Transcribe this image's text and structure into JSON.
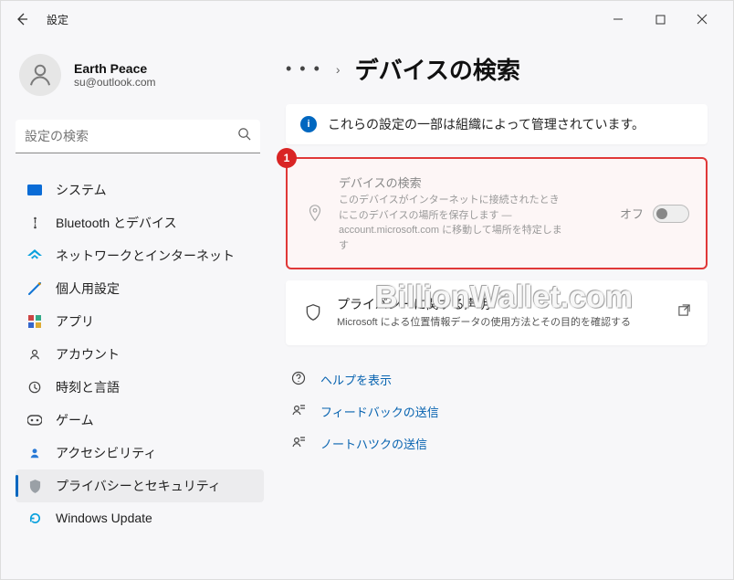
{
  "titlebar": {
    "title": "設定"
  },
  "profile": {
    "name": "Earth Peace",
    "email": "su@outlook.com"
  },
  "search": {
    "placeholder": "設定の検索"
  },
  "nav": [
    {
      "label": "システム",
      "color": "#0a6cd6"
    },
    {
      "label": "Bluetooth とデバイス",
      "color": "#444"
    },
    {
      "label": "ネットワークとインターネット",
      "color": "#0aa1dd"
    },
    {
      "label": "個人用設定",
      "color": "#1275d4"
    },
    {
      "label": "アプリ",
      "color": "#8a5a33"
    },
    {
      "label": "アカウント",
      "color": "#3a3a3a"
    },
    {
      "label": "時刻と言語",
      "color": "#3a3a3a"
    },
    {
      "label": "ゲーム",
      "color": "#3a3a3a"
    },
    {
      "label": "アクセシビリティ",
      "color": "#2a7ad6"
    },
    {
      "label": "プライバシーとセキュリティ",
      "color": "#6f6f6f",
      "active": true
    },
    {
      "label": "Windows Update",
      "color": "#0aa1dd"
    }
  ],
  "main": {
    "page_title": "デバイスの検索",
    "info_banner": "これらの設定の一部は組織によって管理されています。",
    "card": {
      "badge": "1",
      "title": "デバイスの検索",
      "desc": "このデバイスがインターネットに接続されたときにこのデバイスの場所を保存します — account.microsoft.com に移動して場所を特定します",
      "toggle_label": "オフ"
    },
    "privacy": {
      "title": "プライバシーに関する声明",
      "desc": "Microsoft による位置情報データの使用方法とその目的を確認する"
    },
    "links": {
      "help": "ヘルプを表示",
      "feedback": "フィードバックの送信",
      "notes": "ノートハツクの送信"
    }
  },
  "watermark": "BillionWallet.com"
}
